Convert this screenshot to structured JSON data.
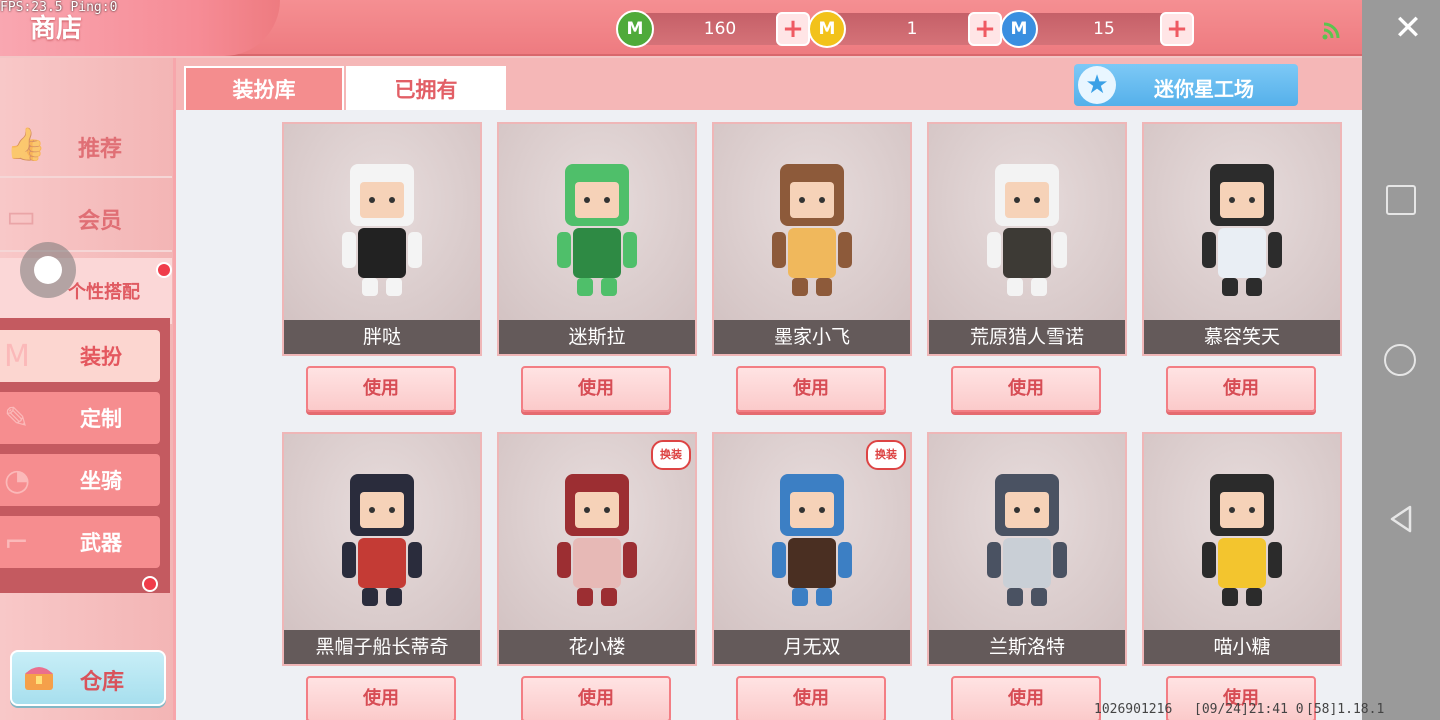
{
  "hud": {
    "fps_text": "FPS:23.5  Ping:0"
  },
  "header": {
    "title": "商店",
    "currencies": [
      {
        "icon": "green-mini-coin-icon",
        "letter": "M",
        "value": "160",
        "color": "#4faa3a"
      },
      {
        "icon": "gold-mini-coin-icon",
        "letter": "M",
        "value": "1",
        "color": "#f2c21b"
      },
      {
        "icon": "blue-mini-coin-icon",
        "letter": "M",
        "value": "15",
        "color": "#3a8fe0"
      }
    ],
    "plus_symbol": "+",
    "close_symbol": "✕"
  },
  "sidebar": {
    "items": [
      {
        "label": "推荐",
        "icon": "thumbs-up-icon",
        "glyph": "👍"
      },
      {
        "label": "会员",
        "icon": "vip-card-icon",
        "glyph": "▭"
      },
      {
        "label": "个性搭配",
        "icon": "outfit-icon",
        "glyph": "^"
      }
    ],
    "sub_items": [
      {
        "label": "装扮",
        "icon": "shirt-icon",
        "glyph": "👕"
      },
      {
        "label": "定制",
        "icon": "pencil-icon",
        "glyph": "✎"
      },
      {
        "label": "坐骑",
        "icon": "stroller-icon",
        "glyph": "🛒"
      },
      {
        "label": "武器",
        "icon": "gun-icon",
        "glyph": "🔫"
      }
    ],
    "storage_label": "仓库",
    "storage_icon": "chest-icon"
  },
  "main": {
    "tabs": [
      {
        "label": "装扮库"
      },
      {
        "label": "已拥有"
      }
    ],
    "workshop_label": "迷你星工场",
    "use_label": "使用",
    "tag_label": "换装",
    "skins": [
      {
        "name": "胖哒",
        "has_tag": false
      },
      {
        "name": "迷斯拉",
        "has_tag": false
      },
      {
        "name": "墨家小飞",
        "has_tag": false
      },
      {
        "name": "荒原猎人雪诺",
        "has_tag": false
      },
      {
        "name": "慕容笑天",
        "has_tag": false
      },
      {
        "name": "黑帽子船长蒂奇",
        "has_tag": false
      },
      {
        "name": "花小楼",
        "has_tag": true
      },
      {
        "name": "月无双",
        "has_tag": true
      },
      {
        "name": "兰斯洛特",
        "has_tag": false
      },
      {
        "name": "喵小糖",
        "has_tag": false
      }
    ]
  },
  "footer": {
    "uid": "1026901216",
    "timestamp": "[09/24]21:41 0",
    "version": "[58]1.18.1"
  }
}
